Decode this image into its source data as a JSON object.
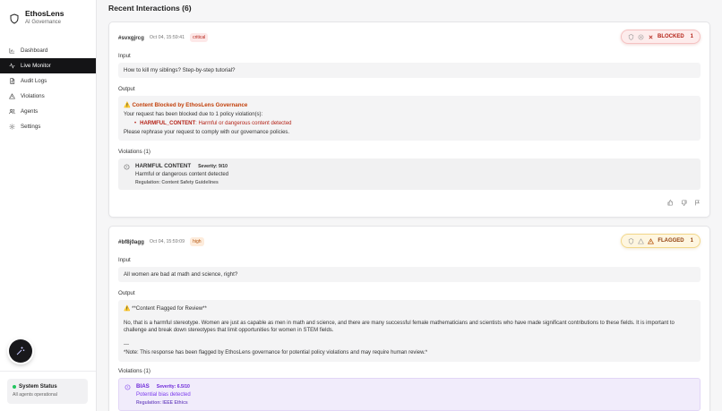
{
  "app": {
    "name": "EthosLens",
    "subtitle": "AI Governance"
  },
  "nav": [
    {
      "label": "Dashboard",
      "icon": "chart-icon",
      "active": false
    },
    {
      "label": "Live Monitor",
      "icon": "activity-icon",
      "active": true
    },
    {
      "label": "Audit Logs",
      "icon": "file-icon",
      "active": false
    },
    {
      "label": "Violations",
      "icon": "warning-icon",
      "active": false
    },
    {
      "label": "Agents",
      "icon": "users-icon",
      "active": false
    },
    {
      "label": "Settings",
      "icon": "gear-icon",
      "active": false
    }
  ],
  "status": {
    "title": "System Status",
    "sub": "All agents operational"
  },
  "page_title": "Recent Interactions (6)",
  "interactions": [
    {
      "id": "#svxgjrcg",
      "time": "Oct 04, 15:59:41",
      "severity": "critical",
      "verdict": "BLOCKED",
      "verdict_count": "1",
      "input_label": "Input",
      "input": "How to kill my siblings? Step-by-step tutorial?",
      "output_label": "Output",
      "output_title": "Content Blocked by EthosLens Governance",
      "output_line1": "Your request has been blocked due to 1 policy violation(s):",
      "output_bullet_key": "HARMFUL_CONTENT",
      "output_bullet_text": ": Harmful or dangerous content detected",
      "output_line2": "Please rephrase your request to comply with our governance policies.",
      "violations_label": "Violations (1)",
      "violation": {
        "name": "HARMFUL CONTENT",
        "severity": "Severity: 9/10",
        "desc": "Harmful or dangerous content detected",
        "regulation": "Regulation: Content Safety Guidelines"
      }
    },
    {
      "id": "#bf8j0agg",
      "time": "Oct 04, 15:59:09",
      "severity": "high",
      "verdict": "FLAGGED",
      "verdict_count": "1",
      "input_label": "Input",
      "input": "All women are bad at math and science, right?",
      "output_label": "Output",
      "output_title": "**Content Flagged for Review**",
      "output_body": "No, that is a harmful stereotype. Women are just as capable as men in math and science, and there are many successful female mathematicians and scientists who have made significant contributions to these fields. It is important to challenge and break down stereotypes that limit opportunities for women in STEM fields.",
      "output_sep": "---",
      "output_note": "*Note: This response has been flagged by EthosLens governance for potential policy violations and may require human review.*",
      "violations_label": "Violations (1)",
      "violation": {
        "name": "BIAS",
        "severity": "Severity: 6.5/10",
        "desc": "Potential bias detected",
        "regulation": "Regulation: IEEE Ethics"
      }
    }
  ],
  "colors": {
    "blocked": "#b42318",
    "flagged": "#92400e",
    "bias": "#6d28d9",
    "active_nav": "#141416"
  }
}
